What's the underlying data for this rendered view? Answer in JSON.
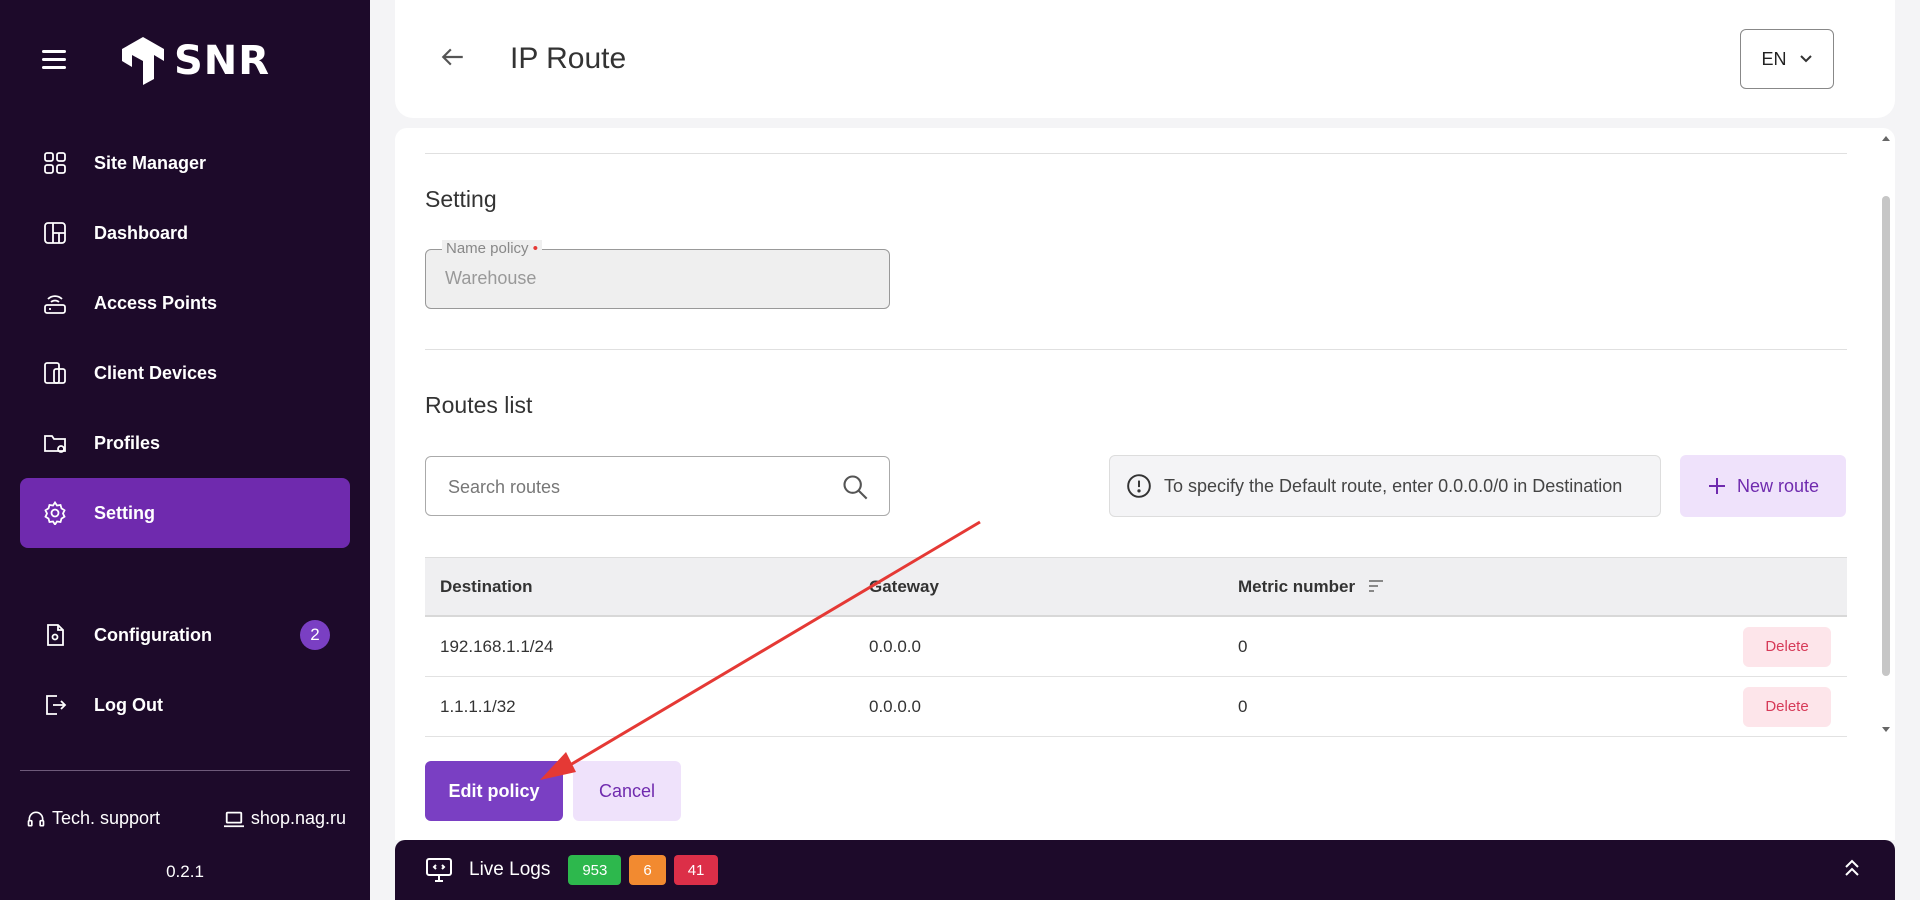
{
  "app": {
    "logo_text": "SNR",
    "version": "0.2.1"
  },
  "sidebar": {
    "items": [
      {
        "label": "Site Manager",
        "icon": "grid-icon"
      },
      {
        "label": "Dashboard",
        "icon": "dashboard-icon"
      },
      {
        "label": "Access Points",
        "icon": "access-point-icon"
      },
      {
        "label": "Client Devices",
        "icon": "devices-icon"
      },
      {
        "label": "Profiles",
        "icon": "folder-settings-icon"
      },
      {
        "label": "Setting",
        "icon": "gear-icon",
        "active": true
      }
    ],
    "secondary": [
      {
        "label": "Configuration",
        "icon": "config-file-icon",
        "badge": "2"
      },
      {
        "label": "Log Out",
        "icon": "logout-icon"
      }
    ],
    "footer": {
      "support_label": "Tech. support",
      "shop_label": "shop.nag.ru"
    }
  },
  "header": {
    "title": "IP Route",
    "language": "EN"
  },
  "setting": {
    "title": "Setting",
    "name_policy_label": "Name policy",
    "name_policy_value": "Warehouse"
  },
  "routes": {
    "title": "Routes list",
    "search_placeholder": "Search routes",
    "info_text": "To specify the Default route, enter 0.0.0.0/0 in Destination",
    "new_route_label": "New route",
    "columns": {
      "destination": "Destination",
      "gateway": "Gateway",
      "metric": "Metric number"
    },
    "rows": [
      {
        "destination": "192.168.1.1/24",
        "gateway": "0.0.0.0",
        "metric": "0",
        "action": "Delete"
      },
      {
        "destination": "1.1.1.1/32",
        "gateway": "0.0.0.0",
        "metric": "0",
        "action": "Delete"
      }
    ]
  },
  "actions": {
    "edit_label": "Edit policy",
    "cancel_label": "Cancel"
  },
  "live_logs": {
    "label": "Live Logs",
    "info_count": "953",
    "warn_count": "6",
    "error_count": "41"
  },
  "colors": {
    "sidebar_bg": "#1d0a2a",
    "accent": "#7a3fc3",
    "active_nav": "#6f2aae",
    "delete": "#d63a58",
    "annotation_arrow": "#e53935"
  }
}
